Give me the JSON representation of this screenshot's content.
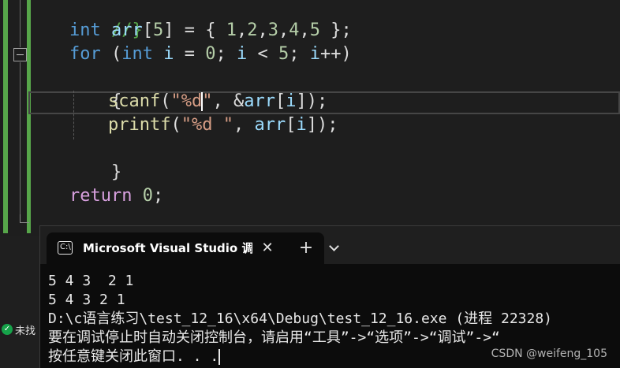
{
  "editor": {
    "lines": [
      {
        "text": "//}"
      },
      {
        "text": "int arr[5] = { 1,2,3,4,5 };"
      },
      {
        "text": "for (int i = 0; i < 5; i++)"
      },
      {
        "text": "{"
      },
      {
        "text": "scanf(\"%d\", &arr[i]);"
      },
      {
        "text": "printf(\"%d \", arr[i]);"
      },
      {
        "text": "}"
      },
      {
        "text": ""
      },
      {
        "text": "return 0;"
      },
      {
        "text": "}"
      }
    ]
  },
  "status": {
    "label": "未找",
    "icon": "check-circle-icon",
    "color": "#16a34a"
  },
  "terminal": {
    "tab_title": "Microsoft Visual Studio 调试控",
    "tab_icon": "terminal-icon",
    "close_icon": "close-icon",
    "new_tab_icon": "plus-icon",
    "dropdown_icon": "chevron-down-icon",
    "output": [
      "5 4 3  2 1",
      "5 4 3 2 1",
      "D:\\c语言练习\\test_12_16\\x64\\Debug\\test_12_16.exe (进程 22328)",
      "要在调试停止时自动关闭控制台，请启用“工具”->“选项”->“调试”->“",
      "按任意键关闭此窗口. . ."
    ]
  },
  "watermark": "CSDN @weifeng_105"
}
